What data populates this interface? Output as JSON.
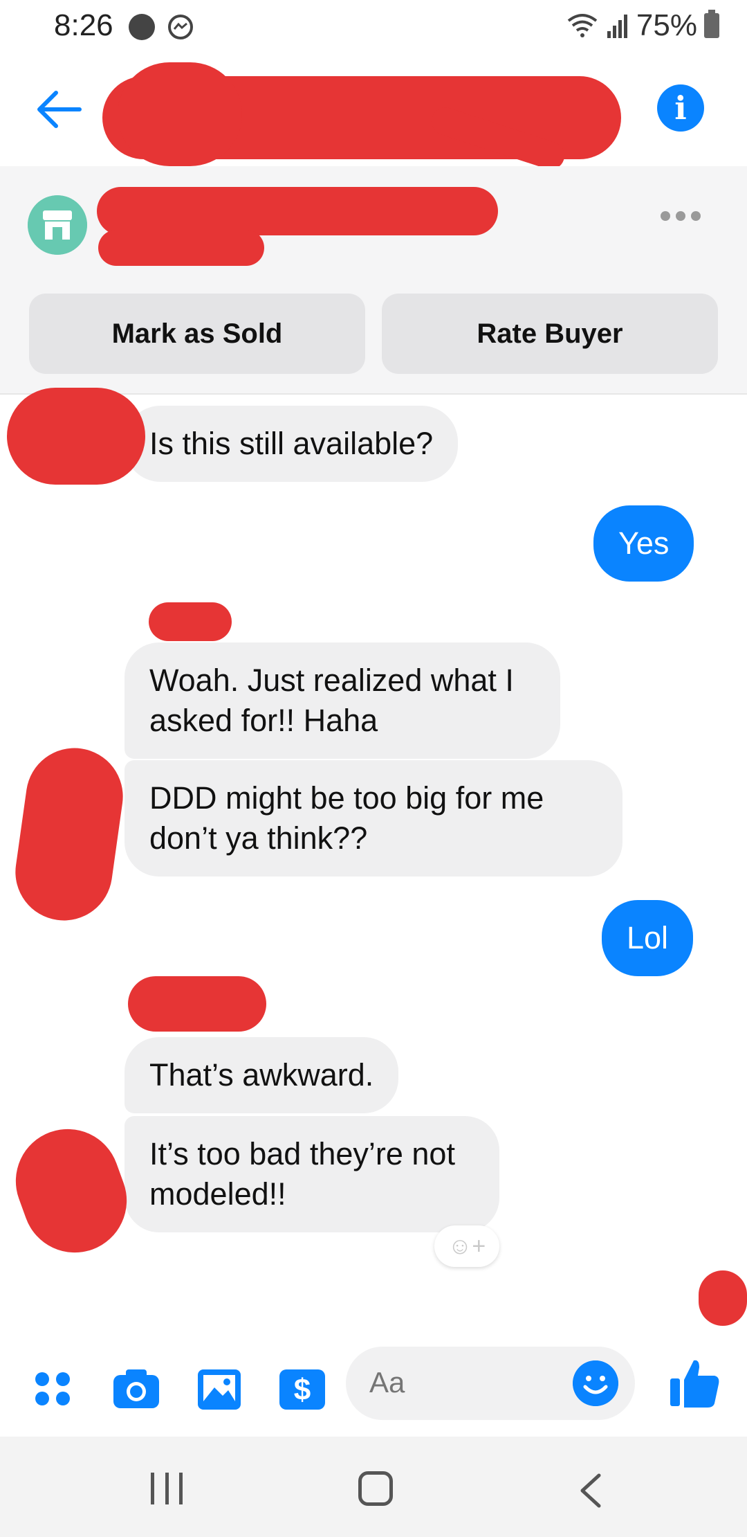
{
  "status_bar": {
    "time": "8:26",
    "battery": "75%"
  },
  "header": {
    "back_icon": "arrow-left-icon",
    "info_icon": "info-icon"
  },
  "listing": {
    "shop_icon": "storefront-icon",
    "more_icon": "more-horizontal-icon",
    "mark_sold_label": "Mark as Sold",
    "rate_buyer_label": "Rate Buyer"
  },
  "messages": [
    {
      "sender": "buyer",
      "text": "Is this still available?"
    },
    {
      "sender": "me",
      "text": "Yes"
    },
    {
      "sender": "buyer",
      "text": "Woah. Just realized what I asked for!! Haha"
    },
    {
      "sender": "buyer",
      "text": "DDD might be too big for me don’t ya think??"
    },
    {
      "sender": "me",
      "text": "Lol"
    },
    {
      "sender": "buyer",
      "text": "That’s awkward."
    },
    {
      "sender": "buyer",
      "text": "It’s too bad they’re not modeled!!"
    }
  ],
  "composer": {
    "placeholder": "Aa",
    "tools": [
      "grid-menu-icon",
      "camera-icon",
      "image-icon",
      "payment-icon",
      "emoji-icon",
      "thumbs-up-icon"
    ]
  },
  "colors": {
    "accent": "#0a84ff",
    "bubble_incoming": "#efeff0",
    "redaction": "#e63535",
    "shop_avatar": "#67c9b1"
  }
}
